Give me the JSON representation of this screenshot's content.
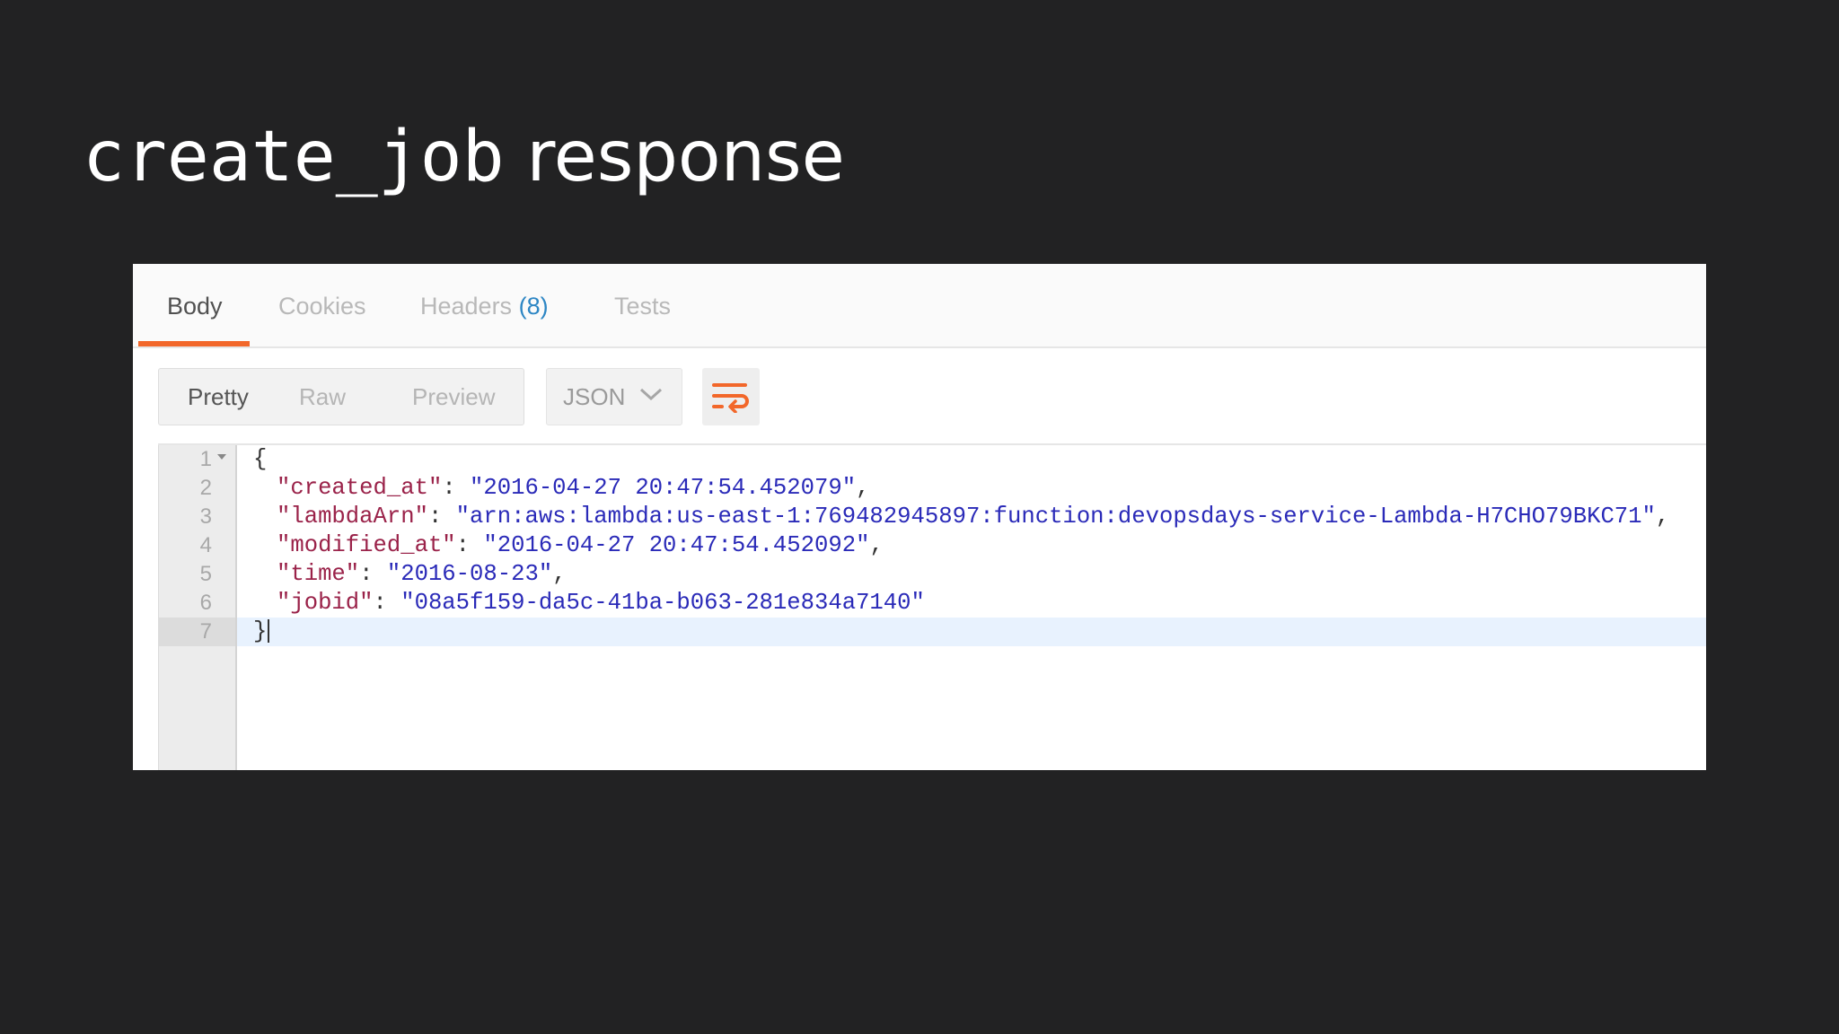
{
  "slide": {
    "title_code": "create_job",
    "title_rest": " response"
  },
  "tabs": [
    {
      "label": "Body"
    },
    {
      "label": "Cookies"
    },
    {
      "label": "Headers",
      "count": "(8)"
    },
    {
      "label": "Tests"
    }
  ],
  "view_modes": [
    "Pretty",
    "Raw",
    "Preview"
  ],
  "format": {
    "selected": "JSON"
  },
  "icons": {
    "format_dropdown": "chevron-down-icon",
    "wrap": "wrap-lines-icon",
    "fold": "fold-arrow-icon"
  },
  "colors": {
    "accent": "#f2672a",
    "key": "#9a2249",
    "string": "#2a2ab8",
    "count": "#2d86c4"
  },
  "lines": [
    {
      "n": "1",
      "open": "{"
    },
    {
      "n": "2",
      "key": "\"created_at\"",
      "sep": ": ",
      "value": "\"2016-04-27 20:47:54.452079\"",
      "tail": ","
    },
    {
      "n": "3",
      "key": "\"lambdaArn\"",
      "sep": ": ",
      "value": "\"arn:aws:lambda:us-east-1:769482945897:function:devopsdays-service-Lambda-H7CHO79BKC71\"",
      "tail": ","
    },
    {
      "n": "4",
      "key": "\"modified_at\"",
      "sep": ": ",
      "value": "\"2016-04-27 20:47:54.452092\"",
      "tail": ","
    },
    {
      "n": "5",
      "key": "\"time\"",
      "sep": ": ",
      "value": "\"2016-08-23\"",
      "tail": ","
    },
    {
      "n": "6",
      "key": "\"jobid\"",
      "sep": ": ",
      "value": "\"08a5f159-da5c-41ba-b063-281e834a7140\"",
      "tail": ""
    },
    {
      "n": "7",
      "close": "}"
    }
  ]
}
